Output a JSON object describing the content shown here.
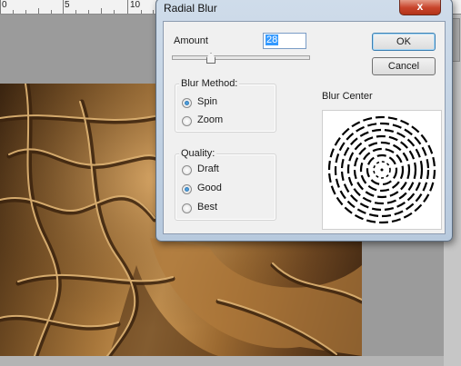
{
  "ruler": {
    "labels": [
      "0",
      "5",
      "10"
    ]
  },
  "dialog": {
    "title": "Radial Blur",
    "close_glyph": "x",
    "amount_label": "Amount",
    "amount_value": "28",
    "amount_fraction": 0.28,
    "ok_label": "OK",
    "cancel_label": "Cancel",
    "blur_method": {
      "title": "Blur Method:",
      "options": [
        "Spin",
        "Zoom"
      ],
      "selected": "Spin"
    },
    "quality": {
      "title": "Quality:",
      "options": [
        "Draft",
        "Good",
        "Best"
      ],
      "selected": "Good"
    },
    "blur_center_label": "Blur Center"
  },
  "colors": {
    "canvas_gray": "#9b9b9b",
    "dialog_frame": "#c2d2e3",
    "close_red": "#c8452c",
    "selection_blue": "#3399ff"
  }
}
